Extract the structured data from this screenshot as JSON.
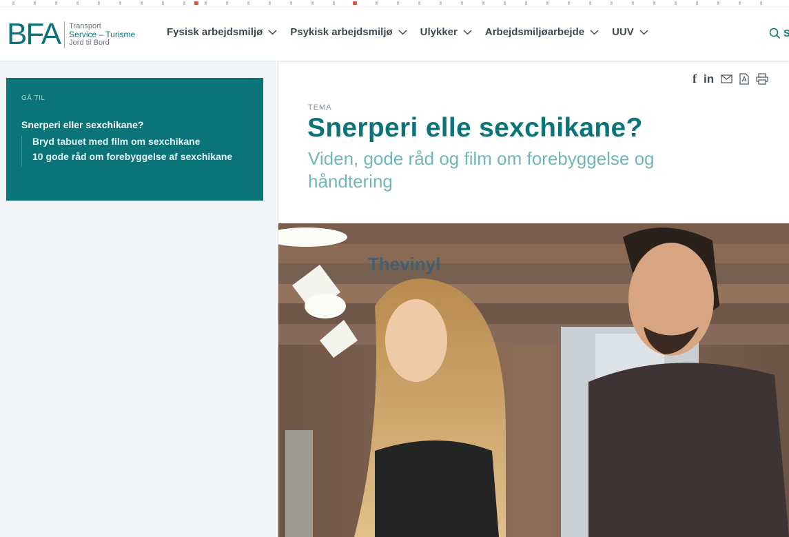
{
  "brand": {
    "mark": "BFA",
    "line1": "Transport",
    "line2": "Service – Turisme",
    "line3": "Jord til Bord",
    "color": "#0b7479"
  },
  "nav": {
    "items": [
      {
        "label": "Fysisk arbejdsmiljø"
      },
      {
        "label": "Psykisk arbejdsmiljø"
      },
      {
        "label": "Ulykker"
      },
      {
        "label": "Arbejdsmiljøarbejde"
      },
      {
        "label": "UUV"
      }
    ],
    "search_icon": "search-icon",
    "search_label": "S"
  },
  "toc": {
    "heading": "GÅ TIL",
    "main": "Snerperi eller sexchikane?",
    "items": [
      "Bryd tabuet med film om sexchikane",
      "10 gode råd om forebyggelse af sexchikane"
    ]
  },
  "share": {
    "icons": [
      "facebook-icon",
      "linkedin-icon",
      "mail-icon",
      "pdf-icon",
      "print-icon"
    ],
    "facebook": "f",
    "linkedin": "in"
  },
  "article": {
    "kicker": "TEMA",
    "title": "Snerperi elle sexchikane?",
    "subtitle": "Viden, gode råd og film om forebyggelse og håndtering"
  },
  "hero": {
    "wall_text": "Thevinyl"
  },
  "colors": {
    "accent": "#0b7479",
    "subtitle": "#6fb7b9",
    "sidebar_bg": "#f2f5f7"
  }
}
